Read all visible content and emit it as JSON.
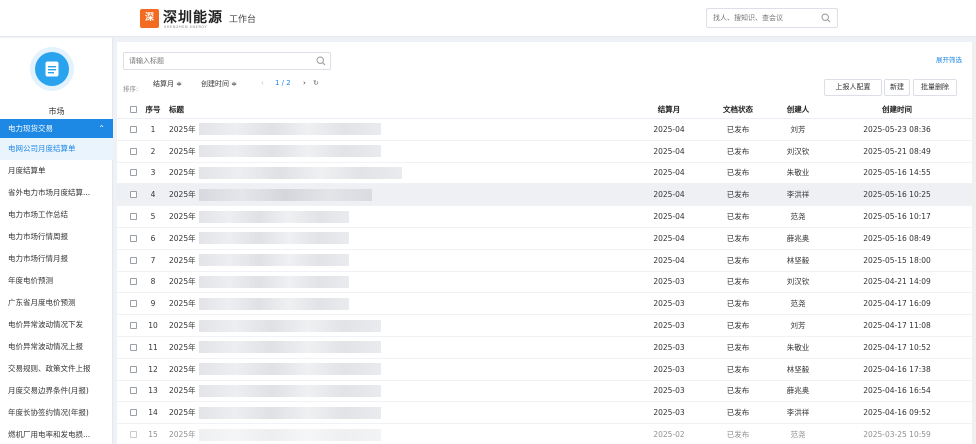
{
  "topbar": {
    "logo_mark": "深",
    "brand": "深圳能源",
    "brand_sub": "SHENZHEN ENERGY",
    "workbench": "工作台",
    "search_placeholder": "找人、搜知识、查会议"
  },
  "sidebar": {
    "app_label": "市场",
    "group_label": "电力现货交易",
    "items": [
      "电网公司月度结算单",
      "月度结算单",
      "省外电力市场月度结算...",
      "电力市场工作总结",
      "电力市场行情周报",
      "电力市场行情月报",
      "年度电价预测",
      "广东省月度电价预测",
      "电价异常波动情况下发",
      "电价异常波动情况上报",
      "交易规则、政策文件上报",
      "月度交易边界条件(月报)",
      "年度长协签约情况(年报)",
      "燃机厂用电率和发电损..."
    ]
  },
  "main": {
    "search_placeholder": "请输入标题",
    "expand_filter": "展开筛选",
    "sort_label": "排序:",
    "sort_month": "结算月 ≑",
    "sort_created": "创建时间 ≑",
    "pager_prev": "‹",
    "pager": "1 / 2",
    "pager_next": "›",
    "refresh": "↻",
    "btn_report": "上报人配置",
    "btn_new": "新建",
    "btn_batch": "批量删除"
  },
  "table": {
    "headers": {
      "no": "序号",
      "title": "标题",
      "month": "结算月",
      "status": "文档状态",
      "creator": "创建人",
      "created": "创建时间"
    },
    "rows": [
      {
        "no": "1",
        "title": "2025年",
        "month": "2025-04",
        "status": "已发布",
        "creator": "刘芳",
        "created": "2025-05-23 08:36"
      },
      {
        "no": "2",
        "title": "2025年",
        "month": "2025-04",
        "status": "已发布",
        "creator": "刘汉钦",
        "created": "2025-05-21 08:49"
      },
      {
        "no": "3",
        "title": "2025年",
        "month": "2025-04",
        "status": "已发布",
        "creator": "朱敬业",
        "created": "2025-05-16 14:55"
      },
      {
        "no": "4",
        "title": "2025年",
        "month": "2025-04",
        "status": "已发布",
        "creator": "李洪祥",
        "created": "2025-05-16 10:25"
      },
      {
        "no": "5",
        "title": "2025年",
        "month": "2025-04",
        "status": "已发布",
        "creator": "范尧",
        "created": "2025-05-16 10:17"
      },
      {
        "no": "6",
        "title": "2025年",
        "month": "2025-04",
        "status": "已发布",
        "creator": "薛兆奥",
        "created": "2025-05-16 08:49"
      },
      {
        "no": "7",
        "title": "2025年",
        "month": "2025-04",
        "status": "已发布",
        "creator": "林坚毅",
        "created": "2025-05-15 18:00"
      },
      {
        "no": "8",
        "title": "2025年",
        "month": "2025-03",
        "status": "已发布",
        "creator": "刘汉钦",
        "created": "2025-04-21 14:09"
      },
      {
        "no": "9",
        "title": "2025年",
        "month": "2025-03",
        "status": "已发布",
        "creator": "范尧",
        "created": "2025-04-17 16:09"
      },
      {
        "no": "10",
        "title": "2025年",
        "month": "2025-03",
        "status": "已发布",
        "creator": "刘芳",
        "created": "2025-04-17 11:08"
      },
      {
        "no": "11",
        "title": "2025年",
        "month": "2025-03",
        "status": "已发布",
        "creator": "朱敬业",
        "created": "2025-04-17 10:52"
      },
      {
        "no": "12",
        "title": "2025年",
        "month": "2025-03",
        "status": "已发布",
        "creator": "林坚毅",
        "created": "2025-04-16 17:38"
      },
      {
        "no": "13",
        "title": "2025年",
        "month": "2025-03",
        "status": "已发布",
        "creator": "薛兆奥",
        "created": "2025-04-16 16:54"
      },
      {
        "no": "14",
        "title": "2025年",
        "month": "2025-03",
        "status": "已发布",
        "creator": "李洪祥",
        "created": "2025-04-16 09:52"
      },
      {
        "no": "15",
        "title": "2025年",
        "month": "2025-02",
        "status": "已发布",
        "creator": "范尧",
        "created": "2025-03-25 10:59"
      }
    ]
  },
  "colors": {
    "accent": "#1e88e5",
    "brand": "#f26b21"
  }
}
